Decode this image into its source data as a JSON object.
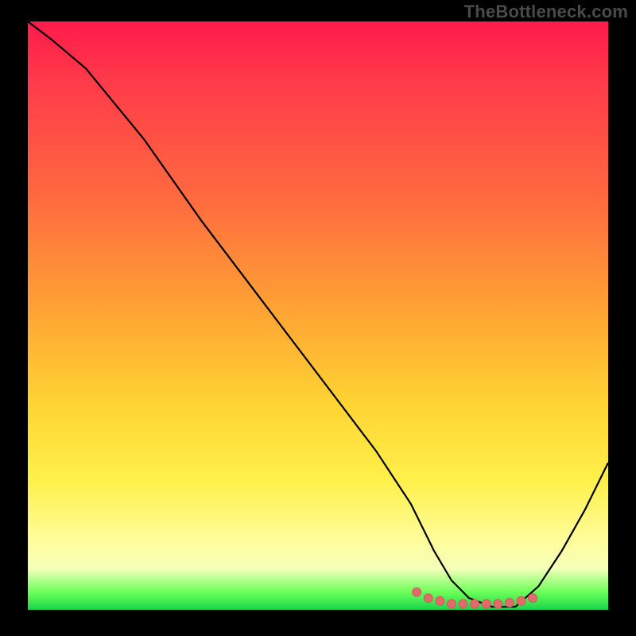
{
  "watermark": "TheBottleneck.com",
  "chart_data": {
    "type": "line",
    "title": "",
    "xlabel": "",
    "ylabel": "",
    "x_range": [
      0,
      100
    ],
    "y_range": [
      0,
      100
    ],
    "grid": false,
    "legend": false,
    "series": [
      {
        "name": "bottleneck-curve",
        "x": [
          0,
          4,
          10,
          20,
          30,
          40,
          50,
          60,
          66,
          70,
          73,
          76,
          80,
          84,
          88,
          92,
          96,
          100
        ],
        "y": [
          100,
          97,
          92,
          80,
          66,
          53,
          40,
          27,
          18,
          10,
          5,
          2,
          0.5,
          0.5,
          4,
          10,
          17,
          25
        ]
      }
    ],
    "highlight_points": {
      "name": "optimal-zone-dots",
      "x": [
        67,
        69,
        71,
        73,
        75,
        77,
        79,
        81,
        83,
        85,
        87
      ],
      "y": [
        3,
        2,
        1.5,
        1,
        1,
        1,
        1,
        1,
        1.2,
        1.5,
        2
      ]
    },
    "background_gradient": {
      "direction": "vertical",
      "stops": [
        {
          "pos": 0,
          "color": "#ff1a4b"
        },
        {
          "pos": 30,
          "color": "#ff6a3f"
        },
        {
          "pos": 65,
          "color": "#ffd433"
        },
        {
          "pos": 88,
          "color": "#fffd9a"
        },
        {
          "pos": 100,
          "color": "#18d648"
        }
      ]
    }
  }
}
